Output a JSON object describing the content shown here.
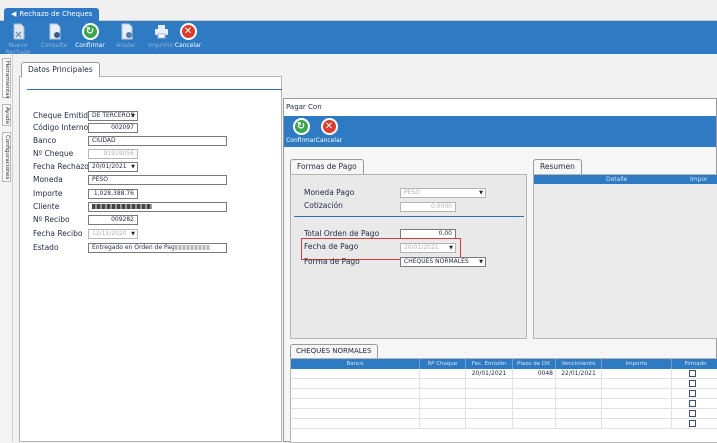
{
  "app_tab": {
    "label": "Rechazo de Cheques"
  },
  "toolbar": [
    {
      "label": "Nuevo Rechazo",
      "icon": "new-document-icon",
      "active": false
    },
    {
      "label": "Consulta",
      "icon": "query-document-icon",
      "active": false
    },
    {
      "label": "Confirmar",
      "icon": "confirm-icon",
      "active": true
    },
    {
      "label": "Anular",
      "icon": "cancel-document-icon",
      "active": false
    },
    {
      "label": "Imprimir",
      "icon": "printer-icon",
      "active": false
    },
    {
      "label": "Cancelar",
      "icon": "cancel-icon",
      "active": true
    }
  ],
  "sidebar_tabs": [
    "Herramientas",
    "Ayuda",
    "Configuraciones"
  ],
  "main": {
    "tab": "Datos Principales",
    "fields": {
      "cheque_emitido": {
        "label": "Cheque Emitido",
        "value": "DE TERCEROS"
      },
      "codigo_interno": {
        "label": "Código Interno",
        "value": "002097"
      },
      "banco": {
        "label": "Banco",
        "value": "CIUDAD"
      },
      "nro_cheque": {
        "label": "Nº Cheque",
        "value": "91919056"
      },
      "fecha_rechazo": {
        "label": "Fecha Rechazo",
        "value": "20/01/2021"
      },
      "moneda": {
        "label": "Moneda",
        "value": "PESO"
      },
      "importe": {
        "label": "Importe",
        "value": "1,028,388.76"
      },
      "cliente": {
        "label": "Cliente",
        "value": ""
      },
      "nro_recibo": {
        "label": "Nº Recibo",
        "value": "009282"
      },
      "fecha_recibo": {
        "label": "Fecha Recibo",
        "value": "12/11/2020"
      },
      "estado": {
        "label": "Estado",
        "value": "Entregado en Orden de Pag"
      }
    }
  },
  "modal": {
    "title": "Pagar Con",
    "toolbar": {
      "confirm": "Confirmar",
      "cancel": "Cancelar"
    },
    "formas_tab": "Formas de Pago",
    "moneda_pago": {
      "label": "Moneda Pago",
      "value": "PESO"
    },
    "cotizacion": {
      "label": "Cotización",
      "value": "0,0000"
    },
    "total_orden": {
      "label": "Total Orden de Pago",
      "value": "0,00"
    },
    "fecha_pago": {
      "label": "Fecha de Pago",
      "value": "20/01/2021"
    },
    "forma_pago": {
      "label": "Forma de Pago",
      "value": "CHEQUES NORMALES"
    },
    "resumen": {
      "tab": "Resumen",
      "columns": [
        "Detalle",
        "Impor"
      ]
    },
    "cheques": {
      "tab": "CHEQUES NORMALES",
      "columns": [
        "Banco",
        "Nº Cheque",
        "Fec. Emisión",
        "Plazo de Dif.",
        "Vencimiento",
        "Importe",
        "Firmado"
      ],
      "rows": [
        {
          "banco": "",
          "nro": "",
          "emision": "20/01/2021",
          "plazo": "0048",
          "vencimiento": "22/01/2021",
          "importe": ""
        },
        {
          "banco": "",
          "nro": "",
          "emision": "",
          "plazo": "",
          "vencimiento": "",
          "importe": ""
        },
        {
          "banco": "",
          "nro": "",
          "emision": "",
          "plazo": "",
          "vencimiento": "",
          "importe": ""
        },
        {
          "banco": "",
          "nro": "",
          "emision": "",
          "plazo": "",
          "vencimiento": "",
          "importe": ""
        },
        {
          "banco": "",
          "nro": "",
          "emision": "",
          "plazo": "",
          "vencimiento": "",
          "importe": ""
        },
        {
          "banco": "",
          "nro": "",
          "emision": "",
          "plazo": "",
          "vencimiento": "",
          "importe": ""
        }
      ]
    }
  }
}
